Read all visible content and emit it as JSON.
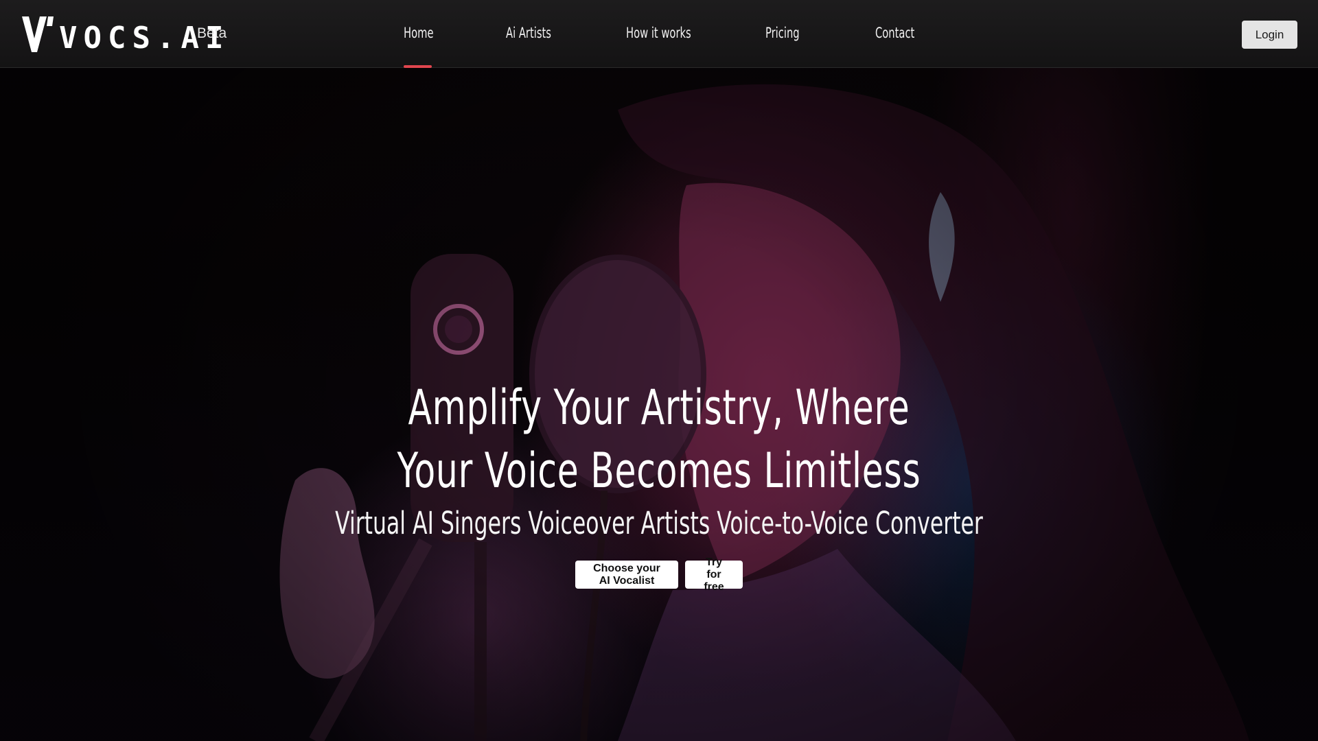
{
  "brand": {
    "logo_text": "VOCS.AI",
    "badge": "Beta"
  },
  "nav": {
    "items": [
      {
        "label": "Home",
        "active": true
      },
      {
        "label": "Ai Artists",
        "active": false
      },
      {
        "label": "How it works",
        "active": false
      },
      {
        "label": "Pricing",
        "active": false
      },
      {
        "label": "Contact",
        "active": false
      }
    ],
    "login_label": "Login"
  },
  "hero": {
    "title_line1": "Amplify Your Artistry, Where",
    "title_line2": "Your Voice Becomes Limitless",
    "subtitle": "Virtual AI Singers Voiceover Artists Voice-to-Voice Converter",
    "primary_cta": "Choose your AI Vocalist",
    "secondary_cta": "Try for free"
  },
  "colors": {
    "nav_background": "#1a191a",
    "active_underline": "#e0464e",
    "login_button": "#e4e4e4",
    "cta_background": "#ffffff",
    "hero_text": "#ffffff"
  },
  "icons": {
    "logo_mark": "vocs-v-logo-icon"
  }
}
